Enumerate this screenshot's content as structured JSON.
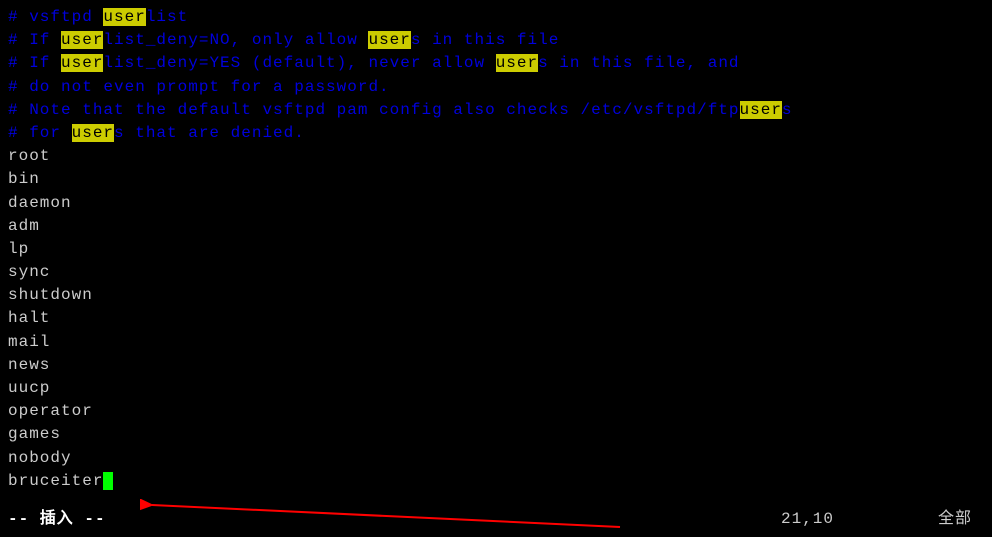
{
  "comments": {
    "line1_pre": "# vsftpd ",
    "line1_hl": "user",
    "line1_post": "list",
    "line2_pre": "# If ",
    "line2_hl1": "user",
    "line2_mid": "list_deny=NO, only allow ",
    "line2_hl2": "user",
    "line2_post": "s in this file",
    "line3_pre": "# If ",
    "line3_hl1": "user",
    "line3_mid": "list_deny=YES (default), never allow ",
    "line3_hl2": "user",
    "line3_post": "s in this file, and",
    "line4": "# do not even prompt for a password.",
    "line5_pre": "# Note that the default vsftpd pam config also checks /etc/vsftpd/ftp",
    "line5_hl": "user",
    "line5_post": "s",
    "line6_pre": "# for ",
    "line6_hl": "user",
    "line6_post": "s that are denied."
  },
  "users": [
    "root",
    "bin",
    "daemon",
    "adm",
    "lp",
    "sync",
    "shutdown",
    "halt",
    "mail",
    "news",
    "uucp",
    "operator",
    "games",
    "nobody",
    "bruceiter"
  ],
  "status": {
    "mode": "-- 插入 --",
    "position": "21,10",
    "view": "全部"
  }
}
